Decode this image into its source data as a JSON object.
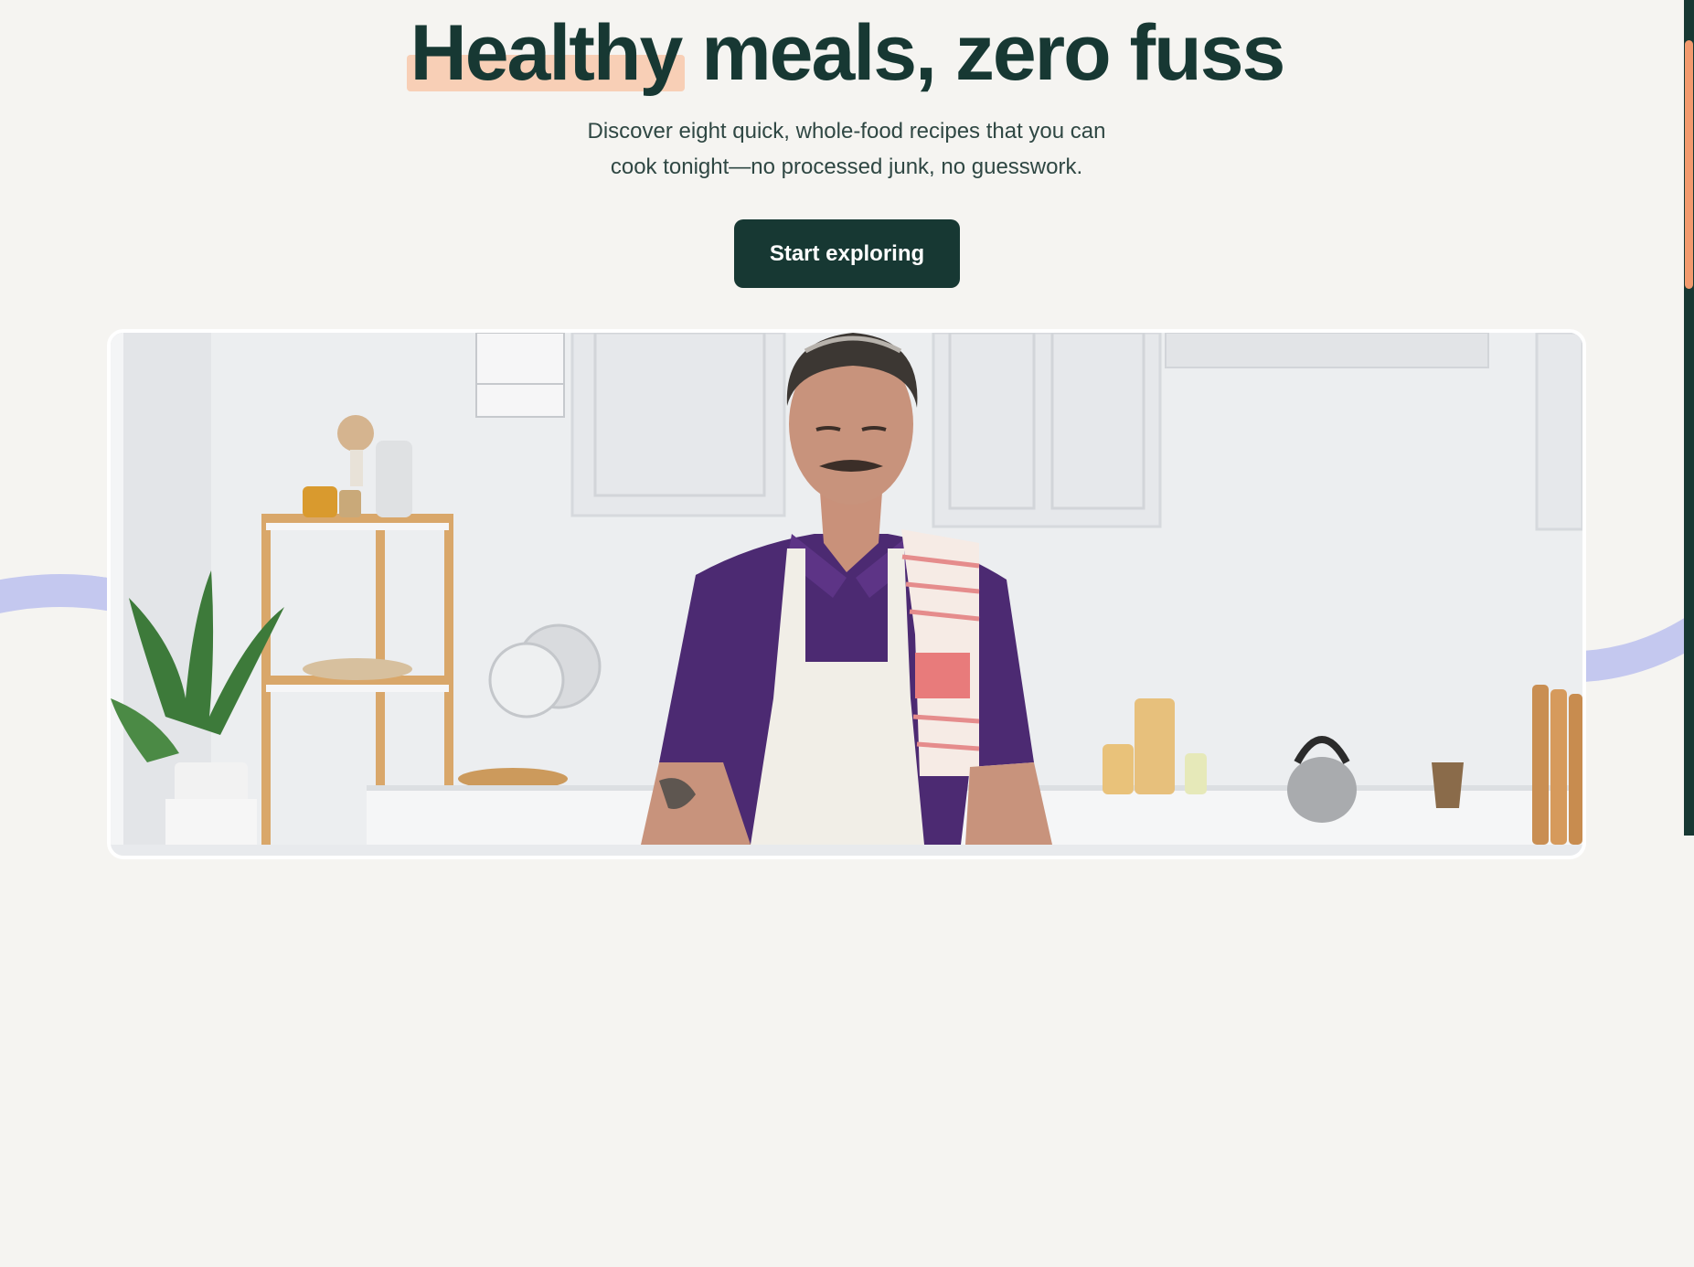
{
  "hero": {
    "title_highlight": "Healthy",
    "title_rest": "meals, zero fuss",
    "subtitle": "Discover eight quick, whole-food recipes that you can cook tonight—no processed junk, no guesswork.",
    "cta_label": "Start exploring"
  },
  "hero_image": {
    "description_icon": "man-cooking-in-kitchen-photo"
  },
  "colors": {
    "background": "#f5f4f1",
    "primary": "#173833",
    "highlight": "#f8cfb6",
    "accent_scroll": "#f29a6e",
    "decor_arc": "#c4c8ef"
  }
}
